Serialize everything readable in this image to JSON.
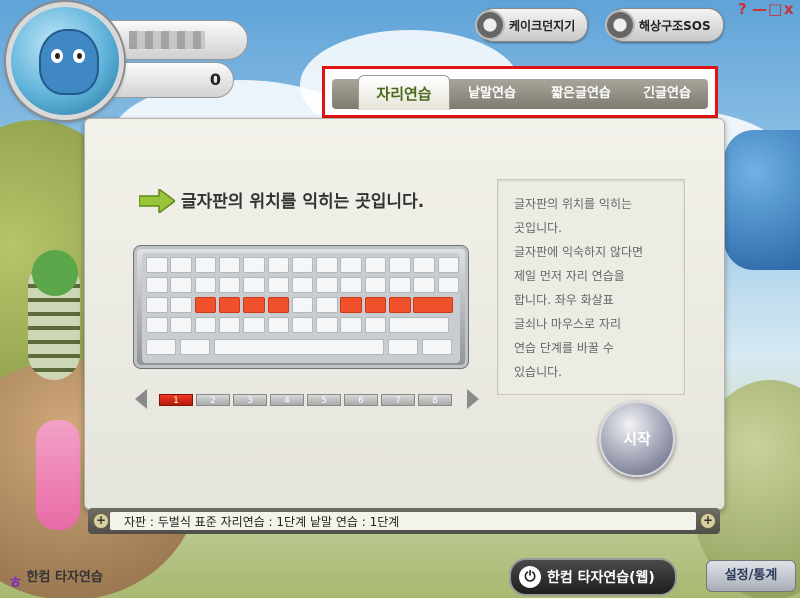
{
  "window": {
    "help_label": "?",
    "minimize_label": "—",
    "maximize_label": "□",
    "close_label": "x"
  },
  "profile": {
    "score": "0"
  },
  "top_buttons": [
    {
      "label": "케이크던지기",
      "icon": "cake-icon"
    },
    {
      "label": "해상구조SOS",
      "icon": "lifebuoy-icon"
    }
  ],
  "tabs": [
    {
      "label": "자리연습",
      "active": true
    },
    {
      "label": "낱말연습",
      "active": false
    },
    {
      "label": "짧은글연습",
      "active": false
    },
    {
      "label": "긴글연습",
      "active": false
    }
  ],
  "main": {
    "heading": "글자판의 위치를 익히는 곳입니다.",
    "description_lines": [
      "글자판의 위치를 익히는",
      "곳입니다.",
      "글자판에 익숙하지 않다면",
      "제일 먼저 자리 연습을",
      "합니다. 좌우 화살표",
      "글쇠나 마우스로 자리",
      "연습 단계를 바꿀 수",
      "있습니다."
    ],
    "start_label": "시작",
    "pages": [
      "1",
      "2",
      "3",
      "4",
      "5",
      "6",
      "7",
      "8"
    ],
    "active_page": "1"
  },
  "status_bar": {
    "text": "자판 : 두벌식 표준    자리연습 : 1단계    낱말 연습 : 1단계",
    "plus_label": "+"
  },
  "bottom": {
    "logo_text": "한컴 타자연습",
    "web_button": "한컴 타자연습(웹)",
    "settings_button": "설정/통계"
  },
  "colors": {
    "accent_red": "#e01212",
    "highlight_key": "#f0502a",
    "tab_active_text": "#4a6a1a"
  }
}
